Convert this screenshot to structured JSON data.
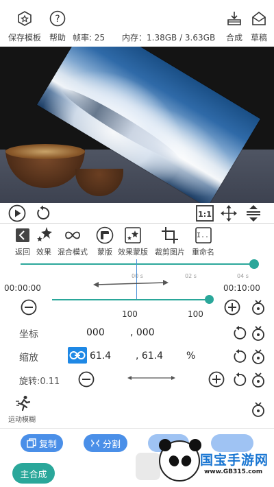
{
  "topbar": {
    "save_template": "保存模板",
    "help": "帮助",
    "fps": "帧率: 25",
    "memory": "内存：1.38GB / 3.63GB",
    "compose": "合成",
    "draft": "草稿"
  },
  "tools": [
    {
      "label": "返回",
      "icon": "back-arrow-icon"
    },
    {
      "label": "效果",
      "icon": "sparkles-icon"
    },
    {
      "label": "混合模式",
      "icon": "infinity-icon"
    },
    {
      "label": "蒙版",
      "icon": "mask-icon"
    },
    {
      "label": "效果蒙版",
      "icon": "effect-mask-icon"
    },
    {
      "label": "裁剪图片",
      "icon": "crop-icon"
    },
    {
      "label": "重命名",
      "icon": "rename-icon"
    }
  ],
  "timeline": {
    "start": "00:00:00",
    "end": "00:10:00",
    "ticks": [
      "00 s",
      "02 s",
      "04 s"
    ],
    "position_fraction": 1.0
  },
  "zoom": {
    "min_label": "100",
    "max_label": "100",
    "level_fraction": 1.0
  },
  "props": {
    "position_label": "坐标",
    "position_x": "000",
    "position_y": ", 000",
    "scale_label": "缩放",
    "scale_x": "61.4",
    "scale_y": ", 61.4",
    "scale_unit": "%",
    "rotate_label": "旋转:0.11",
    "motion_blur_label": "运动模糊"
  },
  "actions": {
    "copy": "复制",
    "split": "分割",
    "main_compose": "主合成"
  },
  "watermark": {
    "title": "国宝手游网",
    "url": "www.GB315.com"
  },
  "colors": {
    "accent": "#2aa79a",
    "blue": "#4a8fe8",
    "link_active": "#1e88e5"
  }
}
